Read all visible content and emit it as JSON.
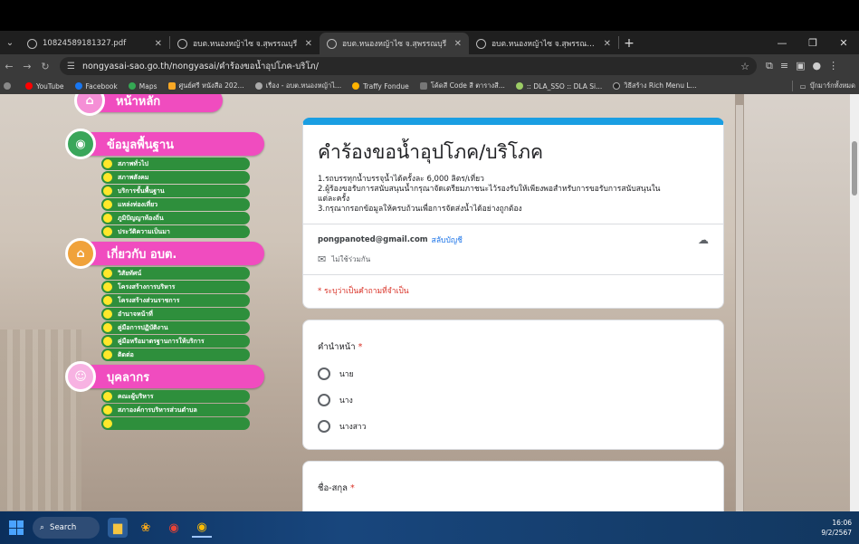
{
  "browser": {
    "tabs": [
      {
        "title": "10824589181327.pdf",
        "active": false
      },
      {
        "title": "อบต.หนองหญ้าไซ จ.สุพรรณบุรี",
        "active": false
      },
      {
        "title": "อบต.หนองหญ้าไซ จ.สุพรรณบุรี",
        "active": true
      },
      {
        "title": "อบต.หนองหญ้าไซ จ.สุพรรณบุรี - อ...",
        "active": false
      }
    ],
    "url": "nongyasai-sao.go.th/nongyasai/คำร้องขอน้ำอุปโภค-บริโภ/",
    "bookmarks": [
      "YouTube",
      "Facebook",
      "Maps",
      "ศูนย์ศรี หนังสือ 202...",
      "เรื่อง - อบต.หนองหญ้าไ...",
      "Traffy Fondue",
      "โค้ดสี Code สี ตารางสี...",
      ":: DLA_SSO :: DLA Si...",
      "วิธีสร้าง Rich Menu L..."
    ],
    "bookmarks_right": "บุ๊กมาร์กทั้งหมด"
  },
  "menu": {
    "home": "หน้าหลัก",
    "sections": [
      {
        "title": "ข้อมูลพื้นฐาน",
        "icon": "globe-icon",
        "items": [
          "สภาพทั่วไป",
          "สภาพสังคม",
          "บริการขั้นพื้นฐาน",
          "แหล่งท่องเที่ยว",
          "ภูมิปัญญาท้องถิ่น",
          "ประวัติความเป็นมา"
        ]
      },
      {
        "title": "เกี่ยวกับ อบต.",
        "icon": "building-icon",
        "items": [
          "วิสัยทัศน์",
          "โครงสร้างการบริหาร",
          "โครงสร้างส่วนราชการ",
          "อำนาจหน้าที่",
          "คู่มือการปฏิบัติงาน",
          "คู่มือหรือมาตรฐานการให้บริการ",
          "ติดต่อ"
        ]
      },
      {
        "title": "บุคลากร",
        "icon": "people-icon",
        "items": [
          "คณะผู้บริหาร",
          "สภาองค์การบริหารส่วนตำบล"
        ]
      }
    ]
  },
  "form": {
    "title": "คำร้องขอน้ำอุปโภค/บริโภค",
    "description": [
      "1.รถบรรทุกน้ำบรรจุน้ำได้ครั้งละ 6,000 ลิตร/เที่ยว",
      "2.ผู้ร้องขอรับการสนับสนุนน้ำกรุณาจัดเตรียมภาชนะไว้รองรับให้เพียงพอสำหรับการขอรับการสนับสนุนใน",
      "แต่ละครั้ง",
      "3.กรุณากรอกข้อมูลให้ครบถ้วนเพื่อการจัดส่งน้ำได้อย่างถูกต้อง"
    ],
    "email": "pongpanoted@gmail.com",
    "switch_account": "สลับบัญชี",
    "not_shared": "ไม่ใช้ร่วมกัน",
    "required_note": "* ระบุว่าเป็นคำถามที่จำเป็น",
    "questions": [
      {
        "title": "คำนำหน้า",
        "required": "*",
        "options": [
          "นาย",
          "นาง",
          "นางสาว"
        ]
      },
      {
        "title": "ชื่อ-สกุล",
        "required": "*"
      }
    ]
  },
  "taskbar": {
    "search": "Search",
    "time": "16:06",
    "date": "9/2/2567"
  }
}
